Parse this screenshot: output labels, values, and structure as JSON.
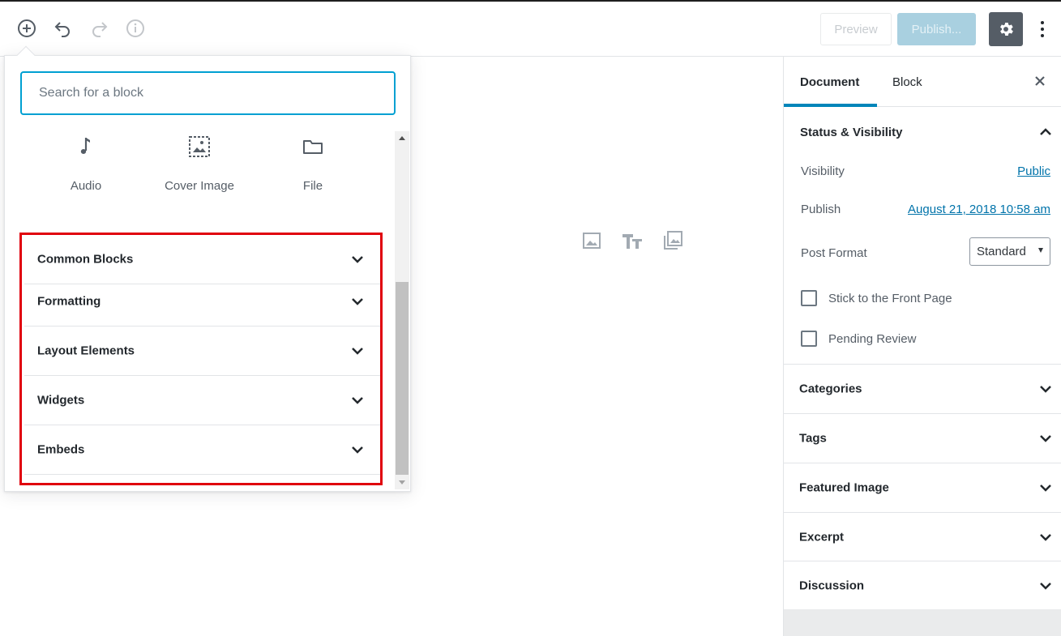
{
  "toolbar": {
    "add_block_icon": "plus-circle-icon",
    "undo_icon": "undo-icon",
    "redo_icon": "redo-icon",
    "info_icon": "info-icon",
    "preview_label": "Preview",
    "publish_label": "Publish...",
    "settings_icon": "gear-icon",
    "more_icon": "vertical-ellipsis-icon"
  },
  "inserter": {
    "search_placeholder": "Search for a block",
    "blocks": [
      {
        "label": "Audio",
        "icon": "audio-icon"
      },
      {
        "label": "Cover Image",
        "icon": "cover-image-icon"
      },
      {
        "label": "File",
        "icon": "folder-icon"
      }
    ],
    "categories": [
      {
        "label": "Common Blocks"
      },
      {
        "label": "Formatting"
      },
      {
        "label": "Layout Elements"
      },
      {
        "label": "Widgets"
      },
      {
        "label": "Embeds"
      }
    ],
    "highlight_color": "#e0000d"
  },
  "canvas": {
    "icons": [
      "image-icon",
      "heading-icon",
      "gallery-icon"
    ]
  },
  "sidebar": {
    "tabs": [
      {
        "label": "Document",
        "active": true
      },
      {
        "label": "Block",
        "active": false
      }
    ],
    "close_icon": "close-icon",
    "status_visibility": {
      "title": "Status & Visibility",
      "visibility_label": "Visibility",
      "visibility_value": "Public",
      "publish_label": "Publish",
      "publish_value": "August 21, 2018 10:58 am",
      "post_format_label": "Post Format",
      "post_format_value": "Standard",
      "stick_label": "Stick to the Front Page",
      "pending_label": "Pending Review"
    },
    "panels": [
      {
        "label": "Categories"
      },
      {
        "label": "Tags"
      },
      {
        "label": "Featured Image"
      },
      {
        "label": "Excerpt"
      },
      {
        "label": "Discussion"
      }
    ],
    "accent_color": "#0085ba",
    "link_color": "#0073aa"
  }
}
